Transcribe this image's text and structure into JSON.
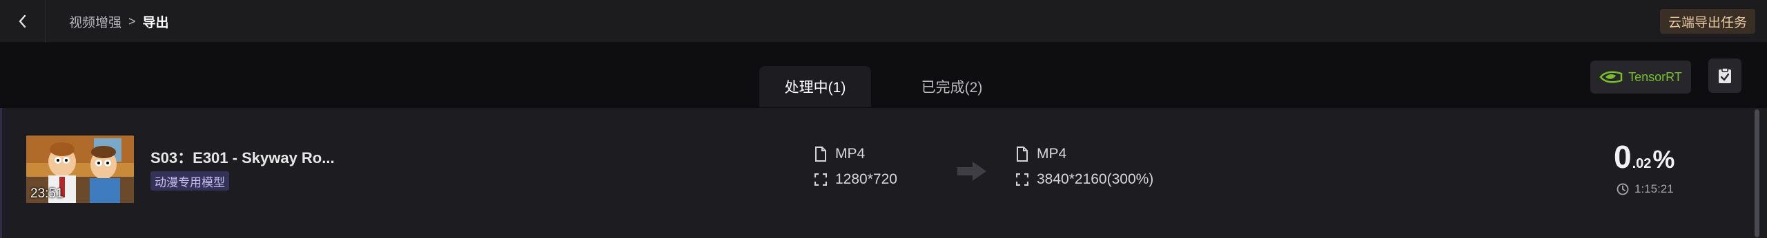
{
  "breadcrumb": {
    "parent": "视频增强",
    "separator": ">",
    "current": "导出"
  },
  "header": {
    "cloud_export_label": "云端导出任务"
  },
  "tabs": [
    {
      "label": "处理中(1)",
      "active": true
    },
    {
      "label": "已完成(2)",
      "active": false
    }
  ],
  "toolbar": {
    "tensorrt_label": "TensorRT"
  },
  "task": {
    "title": "S03：E301 - Skyway Ro...",
    "duration": "23:51",
    "model_tag": "动漫专用模型",
    "source": {
      "format": "MP4",
      "resolution": "1280*720"
    },
    "target": {
      "format": "MP4",
      "resolution": "3840*2160(300%)"
    },
    "progress": {
      "integer": "0",
      "decimal": ".02",
      "unit": "%",
      "value_percent": 0.02
    },
    "time_remaining": "1:15:21"
  },
  "colors": {
    "background": "#0e0e10",
    "panel": "#1d1d21",
    "cloud_button_text": "#e8c9a4",
    "tensorrt_green": "#78c02a",
    "tag_bg": "#35325a"
  },
  "icons": [
    "back-icon",
    "nvidia-icon",
    "clipboard-icon",
    "file-icon",
    "resolution-icon",
    "arrow-right-icon",
    "clock-icon"
  ]
}
